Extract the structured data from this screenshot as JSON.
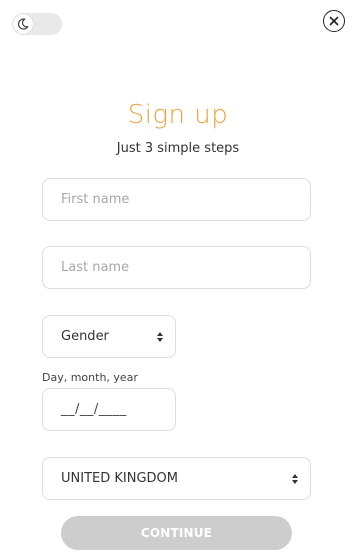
{
  "header": {
    "theme_toggle_icon": "moon-icon",
    "close_icon": "close-icon"
  },
  "form": {
    "title": "Sign up",
    "subtitle": "Just 3 simple steps",
    "first_name_placeholder": "First name",
    "last_name_placeholder": "Last name",
    "gender_label": "Gender",
    "dob_label": "Day, month, year",
    "dob_value": "__/__/____",
    "country_value": "UNITED KINGDOM",
    "continue_label": "CONTINUE"
  },
  "colors": {
    "accent": "#f0a03c",
    "button_disabled": "#cdcdcd",
    "border": "#dddddd"
  }
}
